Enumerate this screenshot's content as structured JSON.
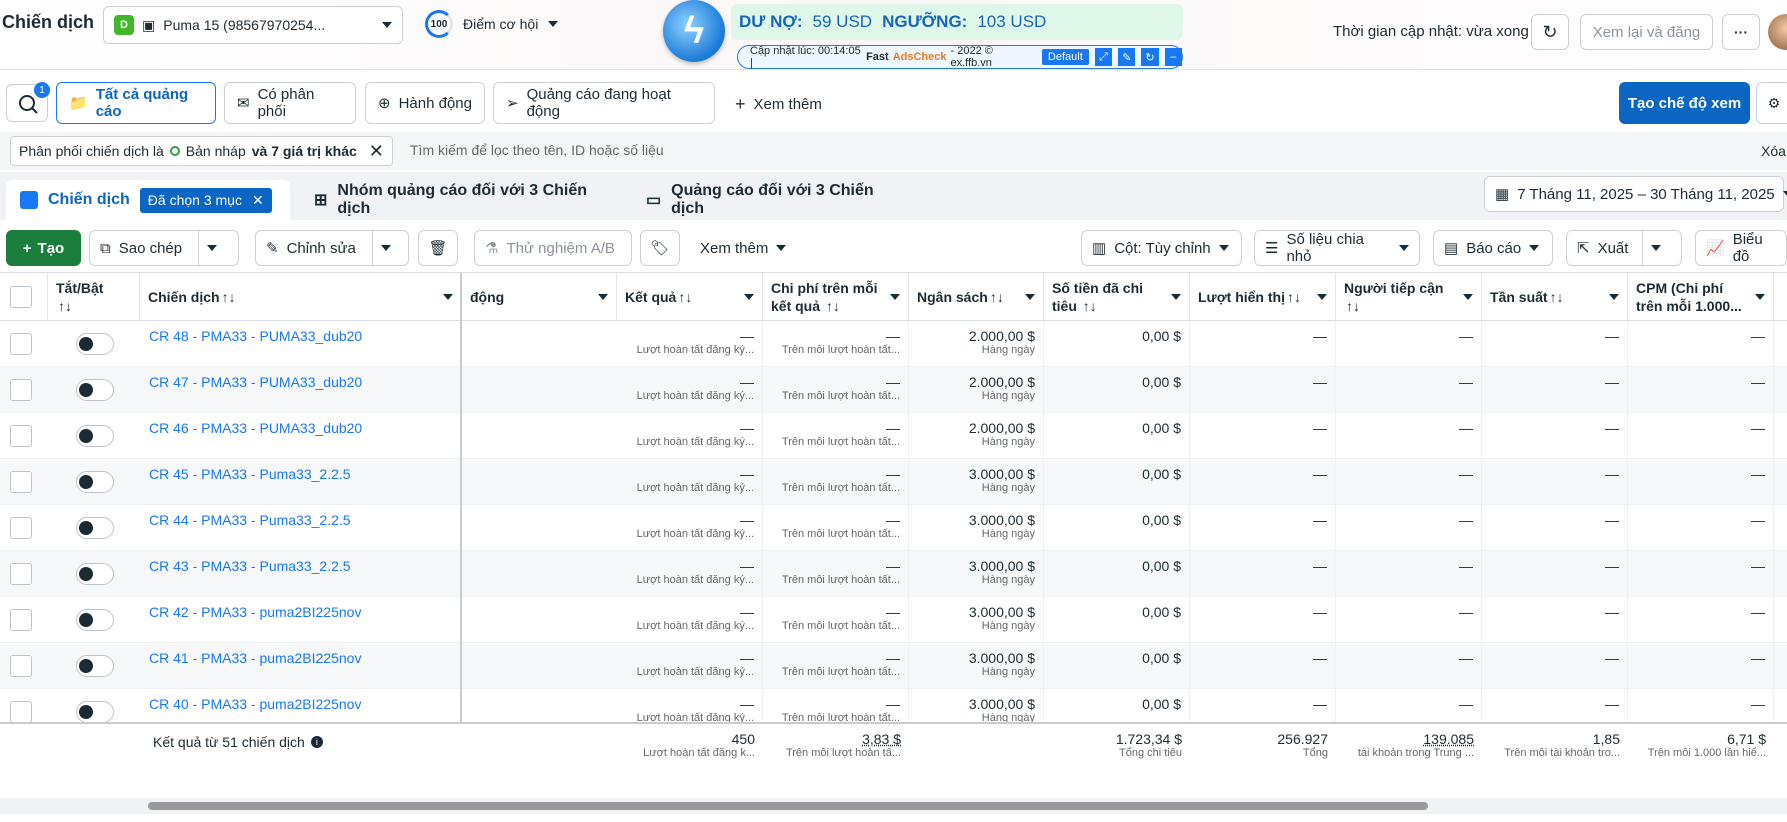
{
  "header": {
    "title": "Chiến dịch",
    "account_badge": "D",
    "account_name": "Puma 15 (98567970254...",
    "score_value": "100",
    "score_label": "Điểm cơ hội",
    "updated_text": "Thời gian cập nhật: vừa xong",
    "review_button": "Xem lại và đăng"
  },
  "extension": {
    "debt_label": "DƯ NỢ:",
    "debt_value": "59 USD",
    "threshold_label": "NGƯỠNG:",
    "threshold_value": "103 USD",
    "updated_at": "Cập nhật lúc: 00:14:05 |",
    "brand_fast": "Fast",
    "brand_adscheck": "AdsCheck",
    "brand_rest": "- 2022 © ex.ffb.vn",
    "preset": "Default"
  },
  "nav": {
    "notif_count": "1",
    "tabs": [
      "Tất cả quảng cáo",
      "Có phân phối",
      "Hành động",
      "Quảng cáo đang hoạt động"
    ],
    "more": "Xem thêm",
    "create_view": "Tạo chế độ xem"
  },
  "filter": {
    "chip_prefix": "Phân phối chiến dịch là",
    "chip_value": "Bản nháp",
    "chip_suffix": "và 7 giá trị khác",
    "search_placeholder": "Tìm kiếm để lọc theo tên, ID hoặc số liệu",
    "clear": "Xóa"
  },
  "levels": {
    "campaign": "Chiến dịch",
    "selected": "Đã chọn 3 mục",
    "adset": "Nhóm quảng cáo đối với 3 Chiến dịch",
    "ads": "Quảng cáo đối với 3 Chiến dịch",
    "date_range": "7 Tháng 11, 2025 – 30 Tháng 11, 2025"
  },
  "toolbar": {
    "create": "Tạo",
    "duplicate": "Sao chép",
    "edit": "Chỉnh sửa",
    "ab_test": "Thử nghiệm A/B",
    "more": "Xem thêm",
    "columns": "Cột: Tùy chỉnh",
    "breakdown": "Số liệu chia nhỏ",
    "reports": "Báo cáo",
    "export": "Xuất",
    "charts": "Biểu đồ"
  },
  "table": {
    "headers": {
      "toggle": "Tắt/Bật",
      "campaign": "Chiến dịch",
      "delivery": "động",
      "results": "Kết quả",
      "cpr": "Chi phí trên mỗi kết quả",
      "budget": "Ngân sách",
      "spent": "Số tiền đã chi tiêu",
      "impressions": "Lượt hiển thị",
      "reach": "Người tiếp cận",
      "frequency": "Tần suất",
      "cpm": "CPM (Chi phí trên mỗi 1.000..."
    },
    "sort_glyph": "↑↓",
    "result_sub": "Lượt hoàn tất đăng ký...",
    "cpr_sub": "Trên mỗi lượt hoàn tất...",
    "budget_sub": "Hàng ngày",
    "dash": "—",
    "rows": [
      {
        "name": "CR 48 - PMA33 - PUMA33_dub20",
        "budget": "2.000,00 $",
        "spent": "0,00 $"
      },
      {
        "name": "CR 47 - PMA33 - PUMA33_dub20",
        "budget": "2.000,00 $",
        "spent": "0,00 $"
      },
      {
        "name": "CR 46 - PMA33 - PUMA33_dub20",
        "budget": "2.000,00 $",
        "spent": "0,00 $"
      },
      {
        "name": "CR 45 - PMA33 - Puma33_2.2.5",
        "budget": "3.000,00 $",
        "spent": "0,00 $"
      },
      {
        "name": "CR 44 - PMA33 - Puma33_2.2.5",
        "budget": "3.000,00 $",
        "spent": "0,00 $"
      },
      {
        "name": "CR 43 - PMA33 - Puma33_2.2.5",
        "budget": "3.000,00 $",
        "spent": "0,00 $"
      },
      {
        "name": "CR 42 - PMA33 - puma2BI225nov",
        "budget": "3.000,00 $",
        "spent": "0,00 $"
      },
      {
        "name": "CR 41 - PMA33 - puma2BI225nov",
        "budget": "3.000,00 $",
        "spent": "0,00 $"
      },
      {
        "name": "CR 40 - PMA33 - puma2BI225nov",
        "budget": "3.000,00 $",
        "spent": "0,00 $"
      }
    ],
    "footer": {
      "label": "Kết quả từ 51 chiến dịch",
      "results": "450",
      "results_sub": "Lượt hoàn tất đăng k...",
      "cpr": "3,83 $",
      "cpr_sub": "Trên mỗi lượt hoàn tấ...",
      "spent": "1.723,34 $",
      "spent_sub": "Tổng chi tiêu",
      "impressions": "256.927",
      "impressions_sub": "Tổng",
      "reach": "139.085",
      "reach_sub": "tài khoản trong Trung ...",
      "frequency": "1,85",
      "frequency_sub": "Trên mỗi tài khoản tro...",
      "cpm": "6,71 $",
      "cpm_sub": "Trên mỗi 1.000 lần hiể..."
    }
  },
  "colors": {
    "primary": "#0a66c2",
    "link": "#1877f2",
    "create_green": "#1b7e3d"
  }
}
